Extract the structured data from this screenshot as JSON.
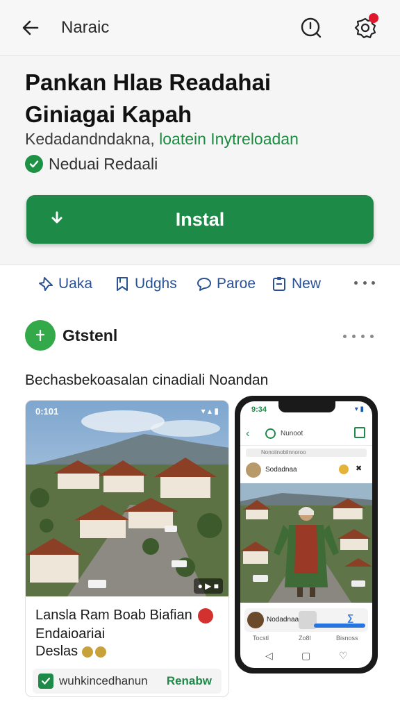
{
  "topbar": {
    "title": "Naraic"
  },
  "app": {
    "title_line1": "Pankan Hlaв Readahai",
    "title_line2": "Giniagai Kapah",
    "subtitle_prefix": "Kedadandndakna, ",
    "developer": "loatein Inytreloadan",
    "verified_label": "Neduai Redaali",
    "install_label": "Instal"
  },
  "actions": [
    {
      "label": "Uaka",
      "icon": "pin-icon"
    },
    {
      "label": "Udghs",
      "icon": "bookmark-icon"
    },
    {
      "label": "Parое",
      "icon": "chat-bubble-icon"
    },
    {
      "label": "New",
      "icon": "clipboard-icon"
    }
  ],
  "section": {
    "title": "Gtstenl",
    "caption": "Bechasbekoasalan cinadiali Noandan"
  },
  "card": {
    "time": "0:101",
    "status": "▾ ▴ ▮",
    "video_badge": "● ▶ ■",
    "title": "Lansla Ram Boab Biafian",
    "subtitle": "Endaioariai",
    "meta": "Deslas",
    "footer_text": "wuhkincedhanun",
    "footer_button": "Renabw"
  },
  "phone": {
    "time": "9:34",
    "status": "▾ ▮",
    "bar_title": "Nunoot",
    "grey_label": "Nonoiinobilnnoroo",
    "post_name": "Sodadnaa",
    "post_close": "✖",
    "bottom_text": "Nodadnaa",
    "tabs": [
      "Tocstl",
      "Zo8l",
      "Bisnoss"
    ],
    "nav": [
      "◁",
      "▢",
      "♡"
    ]
  },
  "colors": {
    "brand_green": "#1e8a47",
    "link_blue": "#2a5192",
    "notification_red": "#e0182d"
  }
}
